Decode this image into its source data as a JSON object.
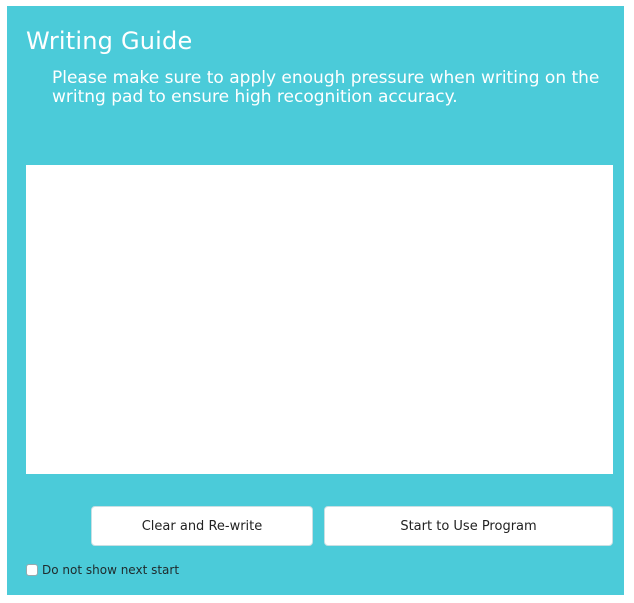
{
  "dialog": {
    "title": "Writing Guide",
    "instruction": "Please make sure to apply enough pressure when writing on the writng pad to ensure high recognition accuracy.",
    "accent_color": "#4bcbd9"
  },
  "buttons": {
    "clear_label": "Clear and Re-write",
    "start_label": "Start to Use Program"
  },
  "options": {
    "dont_show_label": "Do not show next start",
    "dont_show_checked": false
  }
}
